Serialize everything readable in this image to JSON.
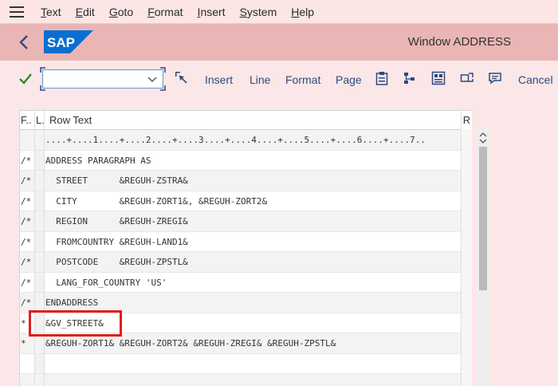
{
  "menu": {
    "items": [
      {
        "mnemonic": "T",
        "rest": "ext"
      },
      {
        "mnemonic": "E",
        "rest": "dit"
      },
      {
        "mnemonic": "G",
        "rest": "oto"
      },
      {
        "mnemonic": "F",
        "rest": "ormat"
      },
      {
        "mnemonic": "I",
        "rest": "nsert"
      },
      {
        "mnemonic": "S",
        "rest": "ystem"
      },
      {
        "mnemonic": "H",
        "rest": "elp"
      }
    ]
  },
  "header": {
    "logo_text": "SAP",
    "window_title": "Window ADDRESS"
  },
  "toolbar": {
    "command_value": "",
    "insert_label": "Insert",
    "line_label": "Line",
    "format_label": "Format",
    "page_label": "Page",
    "cancel_label": "Cancel"
  },
  "table": {
    "headers": {
      "format": "F..",
      "line": "L.",
      "text": "Row Text",
      "right": "R"
    },
    "ruler": "....+....1....+....2....+....3....+....4....+....5....+....6....+....7..",
    "rows": [
      {
        "format": "/*",
        "text": "ADDRESS PARAGRAPH AS"
      },
      {
        "format": "/*",
        "text": "  STREET      &REGUH-ZSTRA&"
      },
      {
        "format": "/*",
        "text": "  CITY        &REGUH-ZORT1&, &REGUH-ZORT2&"
      },
      {
        "format": "/*",
        "text": "  REGION      &REGUH-ZREGI&"
      },
      {
        "format": "/*",
        "text": "  FROMCOUNTRY &REGUH-LAND1&"
      },
      {
        "format": "/*",
        "text": "  POSTCODE    &REGUH-ZPSTL&"
      },
      {
        "format": "/*",
        "text": "  LANG_FOR_COUNTRY 'US'"
      },
      {
        "format": "/*",
        "text": "ENDADDRESS"
      },
      {
        "format": "*",
        "text": "&GV_STREET&"
      },
      {
        "format": "*",
        "text": "&REGUH-ZORT1& &REGUH-ZORT2& &REGUH-ZREGI& &REGUH-ZPSTL&"
      },
      {
        "format": "",
        "text": ""
      },
      {
        "format": "",
        "text": ""
      }
    ]
  },
  "colors": {
    "menubar_bg": "#fbe5e5",
    "titlebar_bg": "#eab5b5",
    "toolbar_link": "#2b4a82",
    "highlight": "#e41c1c",
    "sap_blue": "#0a6ed1"
  }
}
